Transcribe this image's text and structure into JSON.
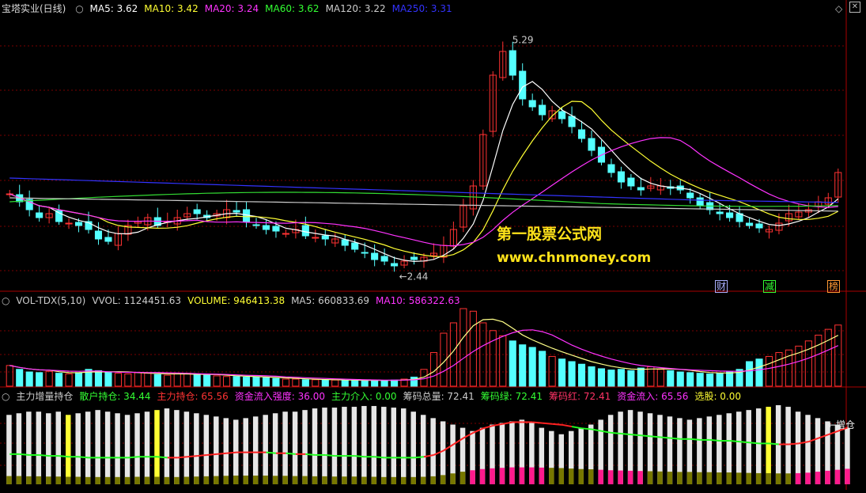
{
  "header": {
    "stock": "宝塔实业(日线)",
    "ma": [
      {
        "label": "MA5: 3.62",
        "color": "#ffffff"
      },
      {
        "label": "MA10: 3.42",
        "color": "#ffff33"
      },
      {
        "label": "MA20: 3.24",
        "color": "#ff33ff"
      },
      {
        "label": "MA60: 3.62",
        "color": "#33ff33"
      },
      {
        "label": "MA120: 3.22",
        "color": "#cccccc"
      },
      {
        "label": "MA250: 3.31",
        "color": "#3333ff"
      }
    ]
  },
  "vol_header": [
    {
      "label": "VOL-TDX(5,10)",
      "color": "#cccccc"
    },
    {
      "label": "VVOL: 1124451.63",
      "color": "#cccccc"
    },
    {
      "label": "VOLUME: 946413.38",
      "color": "#ffff33"
    },
    {
      "label": "MA5: 660833.69",
      "color": "#cccccc"
    },
    {
      "label": "MA10: 586322.63",
      "color": "#ff33ff"
    }
  ],
  "ind_header": [
    {
      "label": "主力增量持仓",
      "color": "#cccccc"
    },
    {
      "label": "散户持仓: 34.44",
      "color": "#33ff33"
    },
    {
      "label": "主力持仓: 65.56",
      "color": "#ff3333"
    },
    {
      "label": "资金流入强度: 36.00",
      "color": "#ff33ff"
    },
    {
      "label": "主力介入: 0.00",
      "color": "#33ff33"
    },
    {
      "label": "筹码总量: 72.41",
      "color": "#cccccc"
    },
    {
      "label": "筹码绿: 72.41",
      "color": "#33ff33"
    },
    {
      "label": "筹码红: 72.41",
      "color": "#ff3366"
    },
    {
      "label": "资金流入: 65.56",
      "color": "#ff33ff"
    },
    {
      "label": "选股: 0.00",
      "color": "#ffff33"
    }
  ],
  "annotations": {
    "high": "5.29",
    "low": "2.44",
    "right_label": "←增仓"
  },
  "tags": [
    {
      "text": "财",
      "color": "#aab0ff"
    },
    {
      "text": "减",
      "color": "#33ff33"
    },
    {
      "text": "榜",
      "color": "#ff9933"
    }
  ],
  "watermark": {
    "line1": "第一股票公式网",
    "line2": "www.chnmoney.com"
  },
  "colors": {
    "up": "#ff3232",
    "down": "#54ffff",
    "grid": "#7a0000"
  },
  "chart_data": {
    "type": "candlestick",
    "ylim": [
      2.2,
      5.6
    ],
    "price_series": [
      3.35,
      3.25,
      3.15,
      3.05,
      3.1,
      3.0,
      2.98,
      2.95,
      2.9,
      2.78,
      2.75,
      2.85,
      2.95,
      3.0,
      3.05,
      2.95,
      3.0,
      3.05,
      3.1,
      3.1,
      3.05,
      3.1,
      3.15,
      3.12,
      3.0,
      2.95,
      2.9,
      2.88,
      2.85,
      2.9,
      2.82,
      2.8,
      2.78,
      2.78,
      2.7,
      2.65,
      2.6,
      2.52,
      2.5,
      2.44,
      2.5,
      2.52,
      2.55,
      2.6,
      2.7,
      2.9,
      3.2,
      3.45,
      4.1,
      4.85,
      5.15,
      4.85,
      4.55,
      4.45,
      4.35,
      4.4,
      4.3,
      4.2,
      4.05,
      3.9,
      3.75,
      3.62,
      3.5,
      3.45,
      3.4,
      3.45,
      3.45,
      3.42,
      3.4,
      3.3,
      3.2,
      3.15,
      3.1,
      3.05,
      3.0,
      2.95,
      2.92,
      2.9,
      2.98,
      3.1,
      3.12,
      3.15,
      3.25,
      3.3,
      3.62
    ],
    "volume": [
      320,
      260,
      220,
      210,
      230,
      200,
      190,
      210,
      260,
      240,
      210,
      200,
      190,
      210,
      200,
      180,
      170,
      190,
      200,
      180,
      170,
      160,
      150,
      150,
      140,
      140,
      130,
      120,
      110,
      110,
      100,
      100,
      95,
      95,
      90,
      90,
      85,
      90,
      90,
      95,
      110,
      140,
      260,
      520,
      820,
      980,
      1200,
      1160,
      980,
      860,
      780,
      700,
      640,
      600,
      540,
      460,
      420,
      380,
      340,
      300,
      270,
      250,
      260,
      240,
      280,
      300,
      260,
      240,
      220,
      210,
      200,
      190,
      200,
      220,
      260,
      380,
      420,
      460,
      520,
      560,
      620,
      700,
      790,
      880,
      946
    ],
    "ma_lines": [
      "MA5",
      "MA10",
      "MA20",
      "MA60",
      "MA120",
      "MA250"
    ],
    "ind_series": {
      "retail": [
        34,
        34,
        33,
        33,
        32,
        32,
        31,
        31,
        30,
        30,
        30,
        30,
        30,
        31,
        31,
        31,
        30,
        30,
        31,
        32,
        33,
        34,
        35,
        36,
        36,
        36,
        36,
        35,
        35,
        34,
        34,
        33,
        33,
        32,
        32,
        32,
        31,
        31,
        30,
        30,
        30,
        30,
        31,
        33,
        38,
        45,
        52,
        58,
        63,
        66,
        68,
        70,
        70,
        70,
        69,
        68,
        67,
        65,
        63,
        62,
        60,
        58,
        57,
        56,
        55,
        54,
        53,
        52,
        51,
        51,
        50,
        50,
        49,
        49,
        48,
        47,
        46,
        46,
        45,
        45,
        46,
        48,
        52,
        56,
        60,
        64
      ],
      "bars": [
        0.86,
        0.88,
        0.9,
        0.9,
        0.88,
        0.9,
        0.86,
        0.88,
        0.9,
        0.92,
        0.9,
        0.88,
        0.86,
        0.88,
        0.9,
        0.92,
        0.94,
        0.92,
        0.9,
        0.88,
        0.86,
        0.84,
        0.82,
        0.8,
        0.82,
        0.84,
        0.86,
        0.88,
        0.9,
        0.9,
        0.92,
        0.94,
        0.95,
        0.95,
        0.96,
        0.96,
        0.97,
        0.97,
        0.96,
        0.95,
        0.94,
        0.9,
        0.86,
        0.82,
        0.78,
        0.74,
        0.7,
        0.66,
        0.7,
        0.74,
        0.76,
        0.78,
        0.8,
        0.76,
        0.7,
        0.66,
        0.62,
        0.66,
        0.7,
        0.74,
        0.8,
        0.86,
        0.9,
        0.92,
        0.9,
        0.88,
        0.86,
        0.84,
        0.82,
        0.8,
        0.82,
        0.84,
        0.86,
        0.88,
        0.9,
        0.92,
        0.94,
        0.96,
        0.98,
        0.96,
        0.9,
        0.86,
        0.82,
        0.78,
        0.74,
        0.7
      ]
    }
  }
}
